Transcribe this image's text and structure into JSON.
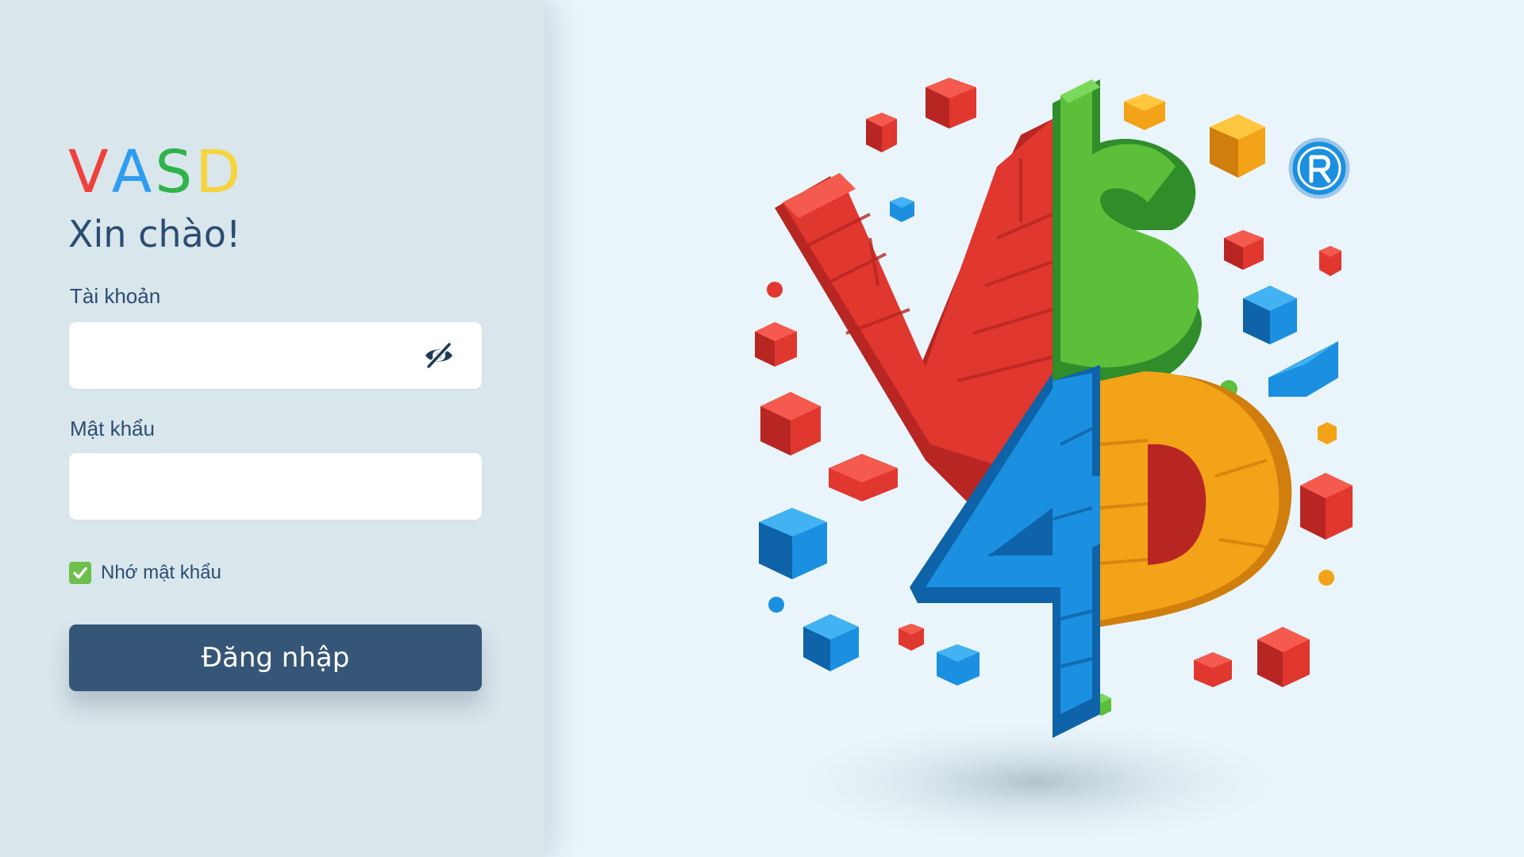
{
  "brand": {
    "letters": [
      {
        "char": "V",
        "color": "#f0413a"
      },
      {
        "char": "A",
        "color": "#2e9df0"
      },
      {
        "char": "S",
        "color": "#2fb34a"
      },
      {
        "char": "D",
        "color": "#f5d43c"
      }
    ]
  },
  "login": {
    "greeting": "Xin chào!",
    "username_label": "Tài khoản",
    "username_value": "",
    "password_label": "Mật khẩu",
    "password_value": "",
    "remember_label": "Nhớ mật khẩu",
    "remember_checked": true,
    "submit_label": "Đăng nhập"
  },
  "icons": {
    "password_toggle": "eye-off-icon",
    "remember_check": "checkmark-icon",
    "illustration_badge": "registered-badge-icon"
  },
  "colors": {
    "panel_bg": "#d9e6ec",
    "page_bg": "#eaf5fb",
    "text": "#2b4d72",
    "button": "#365677",
    "checkbox": "#6cbf4a",
    "logo_red": "#e0372f",
    "logo_green": "#5cbf3a",
    "logo_blue": "#1b8fe0",
    "logo_orange": "#f3a317"
  }
}
